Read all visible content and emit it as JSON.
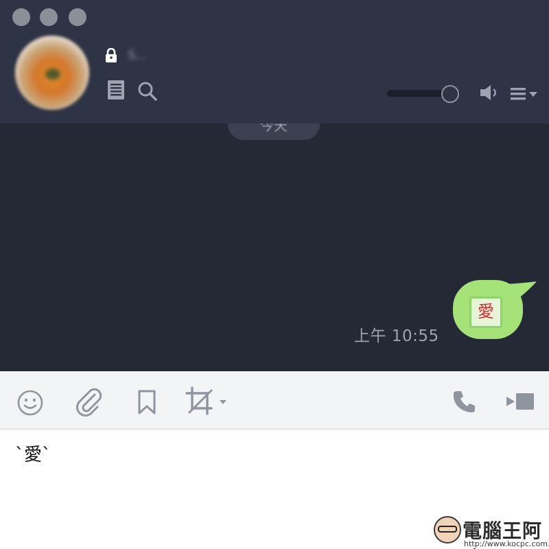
{
  "window": {
    "traffic_lights": [
      "close",
      "minimize",
      "zoom"
    ]
  },
  "header": {
    "contact_name": "S...",
    "icons": [
      "lock-icon",
      "notes-icon",
      "search-icon",
      "speaker-icon",
      "menu-icon"
    ],
    "volume_level": 0.85
  },
  "chat": {
    "date_separator": "今天",
    "messages": [
      {
        "sender": "me",
        "sticker_text": "愛",
        "time": "上午 10:55"
      }
    ]
  },
  "toolbar": {
    "icons": [
      "emoji-icon",
      "paperclip-icon",
      "bookmark-icon",
      "crop-icon",
      "phone-icon",
      "video-call-icon"
    ]
  },
  "input": {
    "value": "`愛`"
  },
  "watermark": {
    "title": "電腦王阿達",
    "url": "http://www.kocpc.com.tw"
  },
  "colors": {
    "header_bg": "#2e3445",
    "chat_bg": "#252935",
    "bubble": "#a5e278",
    "sticker_text": "#e0272d"
  }
}
